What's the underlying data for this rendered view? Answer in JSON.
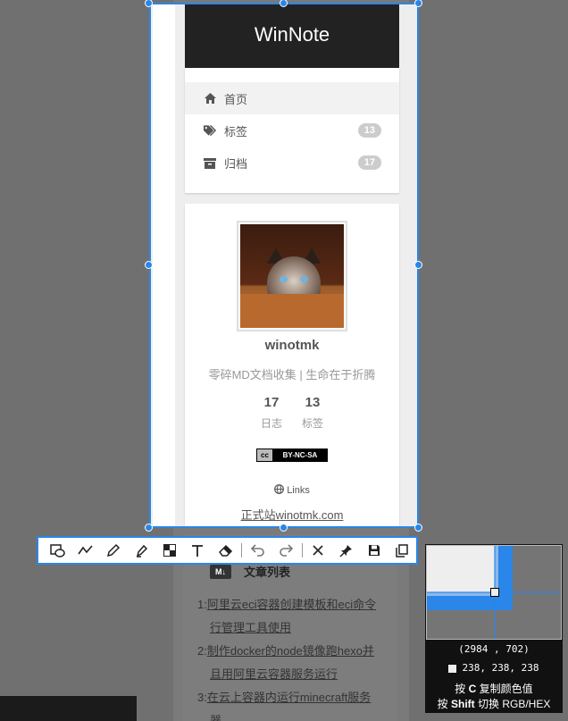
{
  "site": {
    "brand": "WinNote"
  },
  "menu": {
    "items": [
      {
        "label": "首页",
        "icon": "home-icon",
        "badge": null,
        "active": true
      },
      {
        "label": "标签",
        "icon": "tags-icon",
        "badge": "13",
        "active": false
      },
      {
        "label": "归档",
        "icon": "archive-icon",
        "badge": "17",
        "active": false
      }
    ]
  },
  "profile": {
    "name": "winotmk",
    "description": "零碎MD文档收集 | 生命在于折腾",
    "stats": [
      {
        "value": "17",
        "label": "日志"
      },
      {
        "value": "13",
        "label": "标签"
      }
    ],
    "license": {
      "left": "cc",
      "right": "BY-NC-SA"
    },
    "links_title": "Links",
    "link_url": "正式站winotmk.com"
  },
  "posts": {
    "badge": "M↓",
    "title": "文章列表",
    "items": [
      {
        "num": "1:",
        "line1": "阿里云eci容器创建模板和eci命令",
        "line2": "行管理工具使用"
      },
      {
        "num": "2:",
        "line1": "制作docker的node镜像跑hexo并",
        "line2": "且用阿里云容器服务运行"
      },
      {
        "num": "3:",
        "line1": "在云上容器内运行minecraft服务",
        "line2": "器"
      }
    ]
  },
  "toolbar": {
    "tools": [
      "rectangle-ellipse-tool",
      "polyline-tool",
      "pen-tool",
      "marker-tool",
      "mosaic-tool",
      "text-tool",
      "eraser-tool",
      "undo-tool",
      "redo-tool",
      "cancel-tool",
      "pin-tool",
      "save-tool",
      "copy-tool"
    ]
  },
  "magnifier": {
    "coord": "(2984 , 702)",
    "rgb": "238, 238, 238",
    "hint_copy_pre": "按",
    "hint_copy_key": "C",
    "hint_copy_post": "复制颜色值",
    "hint_shift_pre": "按",
    "hint_shift_key": "Shift",
    "hint_shift_post": "切换 RGB/HEX"
  },
  "colors": {
    "selection": "#2a86e8",
    "panel": "#eeeeee",
    "brand_bg": "#222222"
  }
}
